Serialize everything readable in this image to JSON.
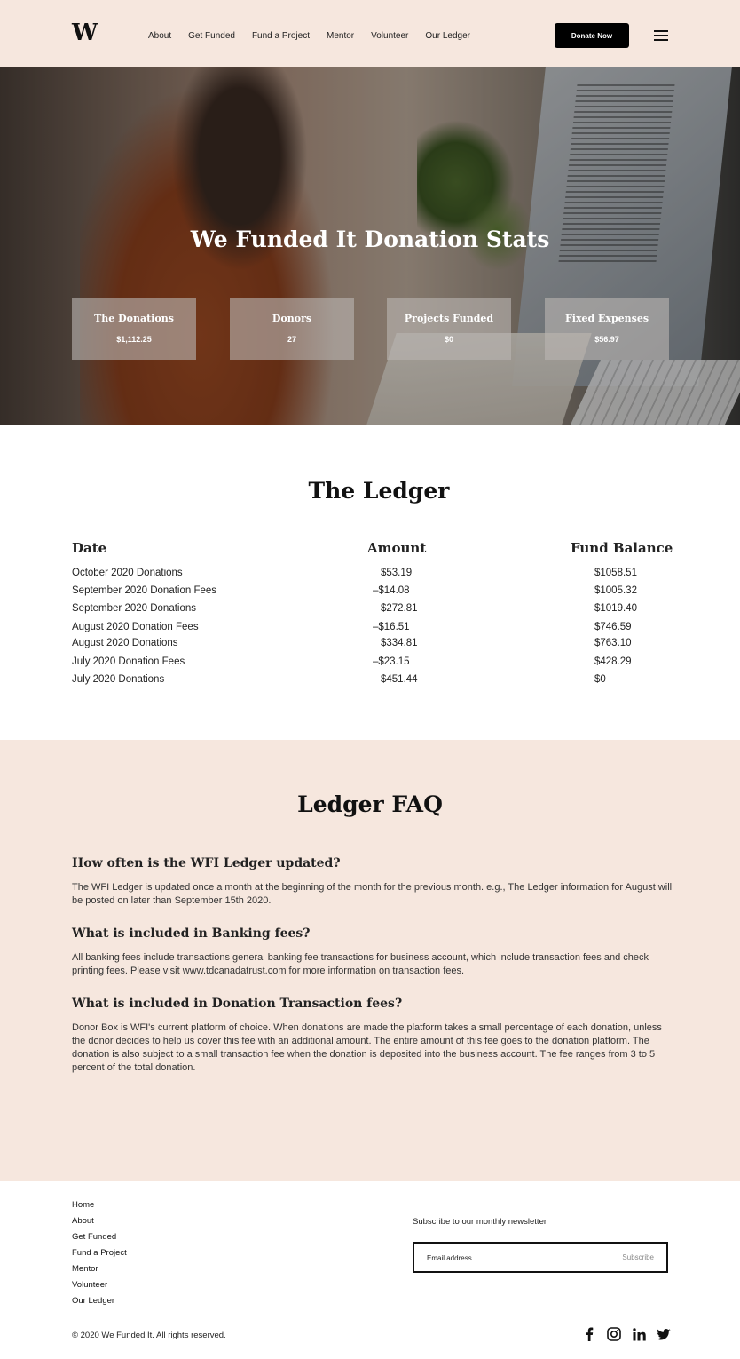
{
  "header": {
    "logo": "W",
    "nav": [
      "About",
      "Get Funded",
      "Fund a Project",
      "Mentor",
      "Volunteer",
      "Our Ledger"
    ],
    "donate_label": "Donate Now"
  },
  "hero": {
    "title": "We Funded It Donation Stats",
    "stats": [
      {
        "label": "The Donations",
        "value": "$1,112.25"
      },
      {
        "label": "Donors",
        "value": "27"
      },
      {
        "label": "Projects Funded",
        "value": "$0"
      },
      {
        "label": "Fixed Expenses",
        "value": "$56.97"
      }
    ]
  },
  "ledger": {
    "title": "The Ledger",
    "columns": [
      "Date",
      "Amount",
      "Fund Balance"
    ],
    "rows": [
      {
        "date": "October 2020 Donations",
        "amount": "  $53.19",
        "balance": "$1058.51"
      },
      {
        "date": "September 2020 Donation Fees",
        "amount": "–$14.08",
        "balance": "$1005.32"
      },
      {
        "date": "September 2020 Donations",
        "amount": "  $272.81",
        "balance": "$1019.40"
      },
      {
        "date": "August 2020 Donation Fees",
        "amount": "–$16.51",
        "balance": "$746.59"
      },
      {
        "date": "August 2020 Donations",
        "amount": "  $334.81",
        "balance": "$763.10"
      },
      {
        "date": "July 2020 Donation Fees",
        "amount": "–$23.15",
        "balance": "$428.29"
      },
      {
        "date": "July 2020 Donations",
        "amount": "  $451.44",
        "balance": "$0"
      }
    ]
  },
  "faq": {
    "title": "Ledger FAQ",
    "items": [
      {
        "q": "How often is the WFI Ledger updated?",
        "a": "The WFI Ledger is updated once a month at the beginning of the month for the previous month. e.g., The Ledger information for August will be posted on later than September 15th 2020."
      },
      {
        "q": "What is included in Banking fees?",
        "a": "All banking fees include transactions general banking fee transactions for business account, which include transaction fees and check printing fees. Please visit www.tdcanadatrust.com for more information on transaction fees."
      },
      {
        "q": "What is included in Donation Transaction fees?",
        "a": "Donor Box is WFI's current platform of choice. When donations are made the platform takes a small percentage of each donation, unless the donor decides to help us cover this fee with an additional amount. The entire amount of this fee goes to the donation platform. The donation is also subject to a small transaction fee when the donation is deposited into the business account. The fee ranges from 3 to 5 percent of the total donation."
      }
    ]
  },
  "footer": {
    "links": [
      "Home",
      "About",
      "Get Funded",
      "Fund a Project",
      "Mentor",
      "Volunteer",
      "Our Ledger"
    ],
    "newsletter_label": "Subscribe to our monthly newsletter",
    "email_placeholder": "Email address",
    "subscribe_label": "Subscribe",
    "copyright": "© 2020 We Funded It. All rights reserved.",
    "socials": [
      "facebook-icon",
      "instagram-icon",
      "linkedin-icon",
      "twitter-icon"
    ]
  }
}
